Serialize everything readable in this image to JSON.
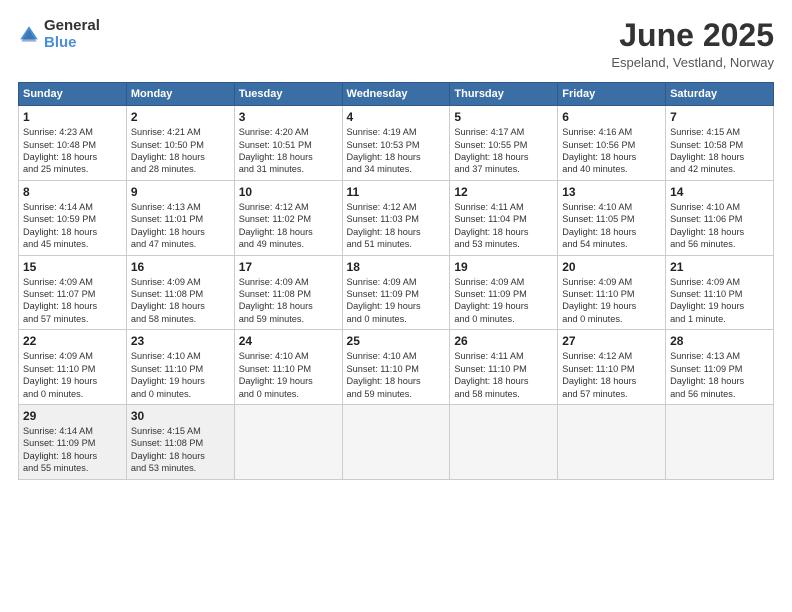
{
  "logo": {
    "general": "General",
    "blue": "Blue"
  },
  "title": "June 2025",
  "location": "Espeland, Vestland, Norway",
  "days_of_week": [
    "Sunday",
    "Monday",
    "Tuesday",
    "Wednesday",
    "Thursday",
    "Friday",
    "Saturday"
  ],
  "weeks": [
    [
      {
        "day": "1",
        "info": "Sunrise: 4:23 AM\nSunset: 10:48 PM\nDaylight: 18 hours\nand 25 minutes."
      },
      {
        "day": "2",
        "info": "Sunrise: 4:21 AM\nSunset: 10:50 PM\nDaylight: 18 hours\nand 28 minutes."
      },
      {
        "day": "3",
        "info": "Sunrise: 4:20 AM\nSunset: 10:51 PM\nDaylight: 18 hours\nand 31 minutes."
      },
      {
        "day": "4",
        "info": "Sunrise: 4:19 AM\nSunset: 10:53 PM\nDaylight: 18 hours\nand 34 minutes."
      },
      {
        "day": "5",
        "info": "Sunrise: 4:17 AM\nSunset: 10:55 PM\nDaylight: 18 hours\nand 37 minutes."
      },
      {
        "day": "6",
        "info": "Sunrise: 4:16 AM\nSunset: 10:56 PM\nDaylight: 18 hours\nand 40 minutes."
      },
      {
        "day": "7",
        "info": "Sunrise: 4:15 AM\nSunset: 10:58 PM\nDaylight: 18 hours\nand 42 minutes."
      }
    ],
    [
      {
        "day": "8",
        "info": "Sunrise: 4:14 AM\nSunset: 10:59 PM\nDaylight: 18 hours\nand 45 minutes."
      },
      {
        "day": "9",
        "info": "Sunrise: 4:13 AM\nSunset: 11:01 PM\nDaylight: 18 hours\nand 47 minutes."
      },
      {
        "day": "10",
        "info": "Sunrise: 4:12 AM\nSunset: 11:02 PM\nDaylight: 18 hours\nand 49 minutes."
      },
      {
        "day": "11",
        "info": "Sunrise: 4:12 AM\nSunset: 11:03 PM\nDaylight: 18 hours\nand 51 minutes."
      },
      {
        "day": "12",
        "info": "Sunrise: 4:11 AM\nSunset: 11:04 PM\nDaylight: 18 hours\nand 53 minutes."
      },
      {
        "day": "13",
        "info": "Sunrise: 4:10 AM\nSunset: 11:05 PM\nDaylight: 18 hours\nand 54 minutes."
      },
      {
        "day": "14",
        "info": "Sunrise: 4:10 AM\nSunset: 11:06 PM\nDaylight: 18 hours\nand 56 minutes."
      }
    ],
    [
      {
        "day": "15",
        "info": "Sunrise: 4:09 AM\nSunset: 11:07 PM\nDaylight: 18 hours\nand 57 minutes."
      },
      {
        "day": "16",
        "info": "Sunrise: 4:09 AM\nSunset: 11:08 PM\nDaylight: 18 hours\nand 58 minutes."
      },
      {
        "day": "17",
        "info": "Sunrise: 4:09 AM\nSunset: 11:08 PM\nDaylight: 18 hours\nand 59 minutes."
      },
      {
        "day": "18",
        "info": "Sunrise: 4:09 AM\nSunset: 11:09 PM\nDaylight: 19 hours\nand 0 minutes."
      },
      {
        "day": "19",
        "info": "Sunrise: 4:09 AM\nSunset: 11:09 PM\nDaylight: 19 hours\nand 0 minutes."
      },
      {
        "day": "20",
        "info": "Sunrise: 4:09 AM\nSunset: 11:10 PM\nDaylight: 19 hours\nand 0 minutes."
      },
      {
        "day": "21",
        "info": "Sunrise: 4:09 AM\nSunset: 11:10 PM\nDaylight: 19 hours\nand 1 minute."
      }
    ],
    [
      {
        "day": "22",
        "info": "Sunrise: 4:09 AM\nSunset: 11:10 PM\nDaylight: 19 hours\nand 0 minutes."
      },
      {
        "day": "23",
        "info": "Sunrise: 4:10 AM\nSunset: 11:10 PM\nDaylight: 19 hours\nand 0 minutes."
      },
      {
        "day": "24",
        "info": "Sunrise: 4:10 AM\nSunset: 11:10 PM\nDaylight: 19 hours\nand 0 minutes."
      },
      {
        "day": "25",
        "info": "Sunrise: 4:10 AM\nSunset: 11:10 PM\nDaylight: 18 hours\nand 59 minutes."
      },
      {
        "day": "26",
        "info": "Sunrise: 4:11 AM\nSunset: 11:10 PM\nDaylight: 18 hours\nand 58 minutes."
      },
      {
        "day": "27",
        "info": "Sunrise: 4:12 AM\nSunset: 11:10 PM\nDaylight: 18 hours\nand 57 minutes."
      },
      {
        "day": "28",
        "info": "Sunrise: 4:13 AM\nSunset: 11:09 PM\nDaylight: 18 hours\nand 56 minutes."
      }
    ],
    [
      {
        "day": "29",
        "info": "Sunrise: 4:14 AM\nSunset: 11:09 PM\nDaylight: 18 hours\nand 55 minutes."
      },
      {
        "day": "30",
        "info": "Sunrise: 4:15 AM\nSunset: 11:08 PM\nDaylight: 18 hours\nand 53 minutes."
      },
      {
        "day": "",
        "info": ""
      },
      {
        "day": "",
        "info": ""
      },
      {
        "day": "",
        "info": ""
      },
      {
        "day": "",
        "info": ""
      },
      {
        "day": "",
        "info": ""
      }
    ]
  ]
}
